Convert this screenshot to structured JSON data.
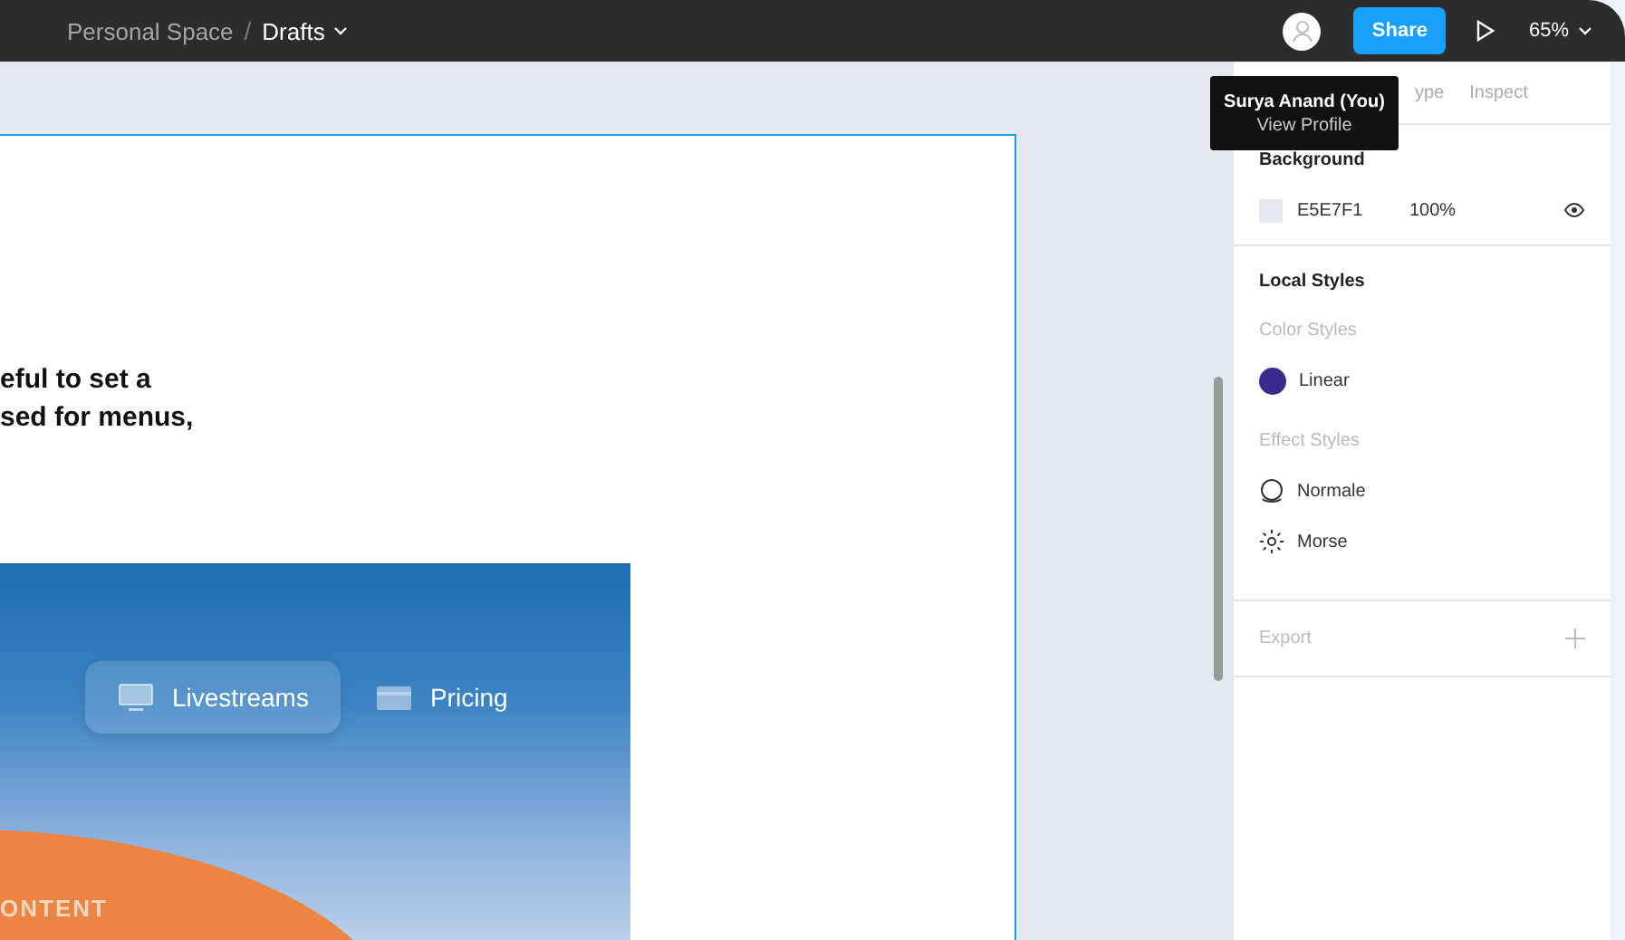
{
  "toolbar": {
    "separator": "/",
    "breadcrumb": [
      {
        "label": "Personal Space",
        "kind": "folder"
      },
      {
        "label": "Drafts",
        "kind": "file"
      }
    ],
    "share_button": "Share",
    "zoom": "65%"
  },
  "tooltip": {
    "title": "Surya Anand (You)",
    "subtitle": "View Profile"
  },
  "canvas": {
    "frame_text": [
      "eful to set a",
      "sed for menus,"
    ],
    "hero": {
      "nav": [
        {
          "label": "Livestreams",
          "kind": "monitor",
          "selected": true
        },
        {
          "label": "Pricing",
          "kind": "card",
          "selected": false
        }
      ],
      "caption": "ONTENT"
    }
  },
  "panel": {
    "tabs": [
      {
        "label": "ype"
      },
      {
        "label": "Inspect"
      }
    ],
    "background": {
      "heading": "Background",
      "hex": "E5E7F1",
      "color": "#e5e7f1",
      "opacity": "100%",
      "visible": true
    },
    "local_styles": {
      "heading": "Local Styles",
      "color_heading": "Color Styles",
      "colors": [
        {
          "name": "Linear",
          "color": "#3b2a8c"
        }
      ],
      "effect_heading": "Effect Styles",
      "effects": [
        {
          "name": "Normale",
          "kind": "shadow"
        },
        {
          "name": "Morse",
          "kind": "blur"
        }
      ]
    },
    "export": {
      "heading": "Export"
    }
  }
}
